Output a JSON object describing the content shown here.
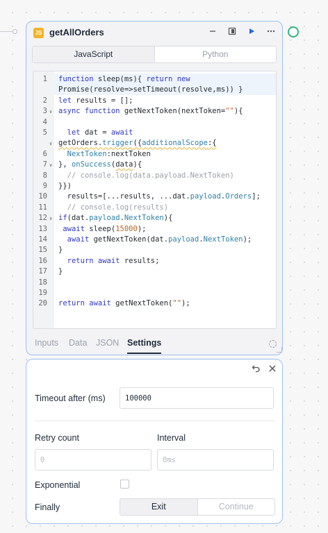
{
  "node": {
    "badge": "JS",
    "title": "getAllOrders",
    "header_icons": [
      "minimize-icon",
      "panel-icon",
      "play-icon",
      "more-icon"
    ],
    "language_tabs": [
      {
        "label": "JavaScript",
        "active": true
      },
      {
        "label": "Python",
        "active": false
      }
    ]
  },
  "code": {
    "lines": [
      {
        "num": "1",
        "fold": false,
        "html": "<span class=\"kw\">function</span> sleep(ms){ <span class=\"kw\">return new</span>"
      },
      {
        "num": "",
        "fold": false,
        "html": "Promise(resolve=>setTimeout(resolve,ms)) }"
      },
      {
        "num": "2",
        "fold": false,
        "html": "<span class=\"kw\">let</span> results = [];"
      },
      {
        "num": "3",
        "fold": true,
        "html": "<span class=\"kw\">async function</span> getNextToken(nextToken=<span class=\"str\">\"\"</span>){"
      },
      {
        "num": "4",
        "fold": false,
        "html": ""
      },
      {
        "num": "5",
        "fold": false,
        "html": "  <span class=\"kw\">let</span> dat = <span class=\"kw\">await</span>"
      },
      {
        "num": "",
        "fold": true,
        "html": "<span class=\"squig\">getOrders.<span class=\"prop\">trigger</span>({<span class=\"prop\">additionalScope</span>:{</span>"
      },
      {
        "num": "6",
        "fold": false,
        "html": "  <span class=\"prop\">NextToken</span>:nextToken"
      },
      {
        "num": "7",
        "fold": true,
        "html": "}, <span class=\"prop\">onSuccess</span>(<span class=\"squig\">data</span>){"
      },
      {
        "num": "8",
        "fold": false,
        "html": "  <span class=\"cmt\">// console.log(data.payload.NextToken)</span>"
      },
      {
        "num": "9",
        "fold": false,
        "html": "}})"
      },
      {
        "num": "10",
        "fold": false,
        "html": "  results=[...results, ...dat.<span class=\"prop\">payload</span>.<span class=\"prop\">Orders</span>];"
      },
      {
        "num": "11",
        "fold": false,
        "html": "  <span class=\"cmt\">// console.log(results)</span>"
      },
      {
        "num": "12",
        "fold": true,
        "html": "<span class=\"kw\">if</span>(dat.<span class=\"prop\">payload</span>.<span class=\"prop\">NextToken</span>){"
      },
      {
        "num": "13",
        "fold": false,
        "html": " <span class=\"kw\">await</span> sleep(<span class=\"num\">15000</span>);"
      },
      {
        "num": "14",
        "fold": false,
        "html": "  <span class=\"kw\">await</span> getNextToken(dat.<span class=\"prop\">payload</span>.<span class=\"prop\">NextToken</span>);"
      },
      {
        "num": "15",
        "fold": false,
        "html": "}"
      },
      {
        "num": "16",
        "fold": false,
        "html": "  <span class=\"kw\">return await</span> results;"
      },
      {
        "num": "17",
        "fold": false,
        "html": "}"
      },
      {
        "num": "18",
        "fold": false,
        "html": ""
      },
      {
        "num": "19",
        "fold": false,
        "html": ""
      },
      {
        "num": "20",
        "fold": false,
        "html": "<span class=\"kw\">return await</span> getNextToken(<span class=\"str\">\"\"</span>);"
      }
    ]
  },
  "bottom_tabs": [
    {
      "label": "Inputs",
      "active": false
    },
    {
      "label": "Data",
      "active": false
    },
    {
      "label": "JSON",
      "active": false
    },
    {
      "label": "Settings",
      "active": true
    }
  ],
  "settings": {
    "timeout_label": "Timeout after (ms)",
    "timeout_value": "100000",
    "retry_label": "Retry count",
    "retry_placeholder": "0",
    "interval_label": "Interval",
    "interval_placeholder": "0ms",
    "exponential_label": "Exponential",
    "exponential_checked": false,
    "finally_label": "Finally",
    "finally_options": [
      {
        "label": "Exit",
        "active": true
      },
      {
        "label": "Continue",
        "active": false
      }
    ]
  }
}
